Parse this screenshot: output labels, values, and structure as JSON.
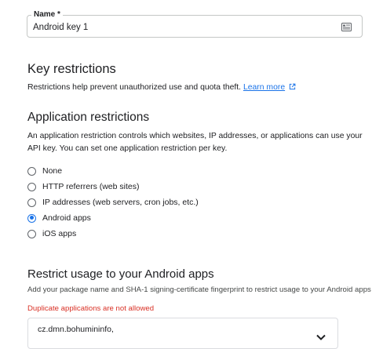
{
  "name_field": {
    "label": "Name *",
    "value": "Android key 1",
    "icon": "form-icon"
  },
  "key_restrictions": {
    "title": "Key restrictions",
    "description": "Restrictions help prevent unauthorized use and quota theft.",
    "learn_more": "Learn more",
    "learn_more_icon": "external-link-icon"
  },
  "application_restrictions": {
    "title": "Application restrictions",
    "description": "An application restriction controls which websites, IP addresses, or applications can use your API key. You can set one application restriction per key.",
    "options": [
      {
        "label": "None",
        "checked": false
      },
      {
        "label": "HTTP referrers (web sites)",
        "checked": false
      },
      {
        "label": "IP addresses (web servers, cron jobs, etc.)",
        "checked": false
      },
      {
        "label": "Android apps",
        "checked": true
      },
      {
        "label": "iOS apps",
        "checked": false
      }
    ]
  },
  "restrict_android": {
    "title": "Restrict usage to your Android apps",
    "description": "Add your package name and SHA-1 signing-certificate fingerprint to restrict usage to your Android apps",
    "error": "Duplicate applications are not allowed",
    "app_item": "cz.dmn.bohumininfo,",
    "app_item_icon": "chevron-down-icon"
  },
  "colors": {
    "accent": "#1a73e8",
    "error": "#d93025",
    "text": "#202124"
  }
}
